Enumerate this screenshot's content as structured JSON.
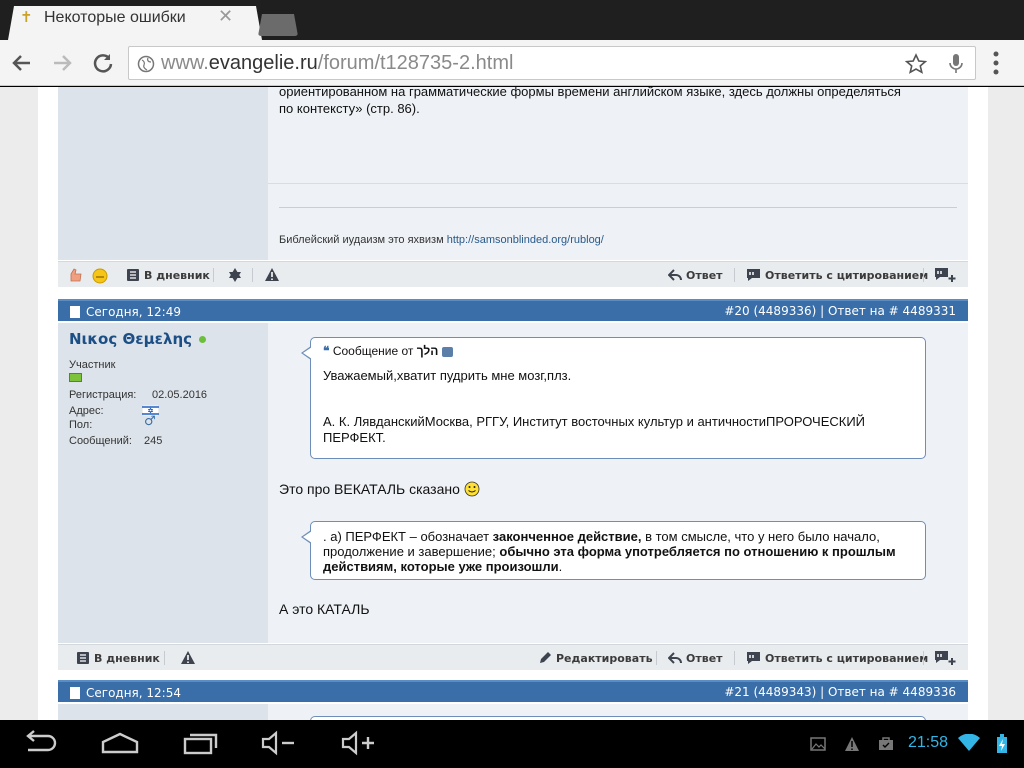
{
  "browser": {
    "tab_title": "Некоторые ошибки",
    "url_prefix": "www.",
    "url_host": "evangelie.ru",
    "url_path": "/forum/t128735-2.html"
  },
  "post19": {
    "text_line1": "ориентированном на грамматические формы времени английском языке, здесь должны определяться",
    "text_line2": "по контексту» (стр. 86).",
    "signature_prefix": "Библейский иудаизм это яхвизм",
    "signature_link": "http://samsonblinded.org/rublog/",
    "actions": {
      "diary": "В дневник",
      "reply": "Ответ",
      "reply_quote": "Ответить с цитированием"
    }
  },
  "post20": {
    "date": "Сегодня, 12:49",
    "post_ref": "#20 (4489336)",
    "reply_to": "Ответ на # 4489331",
    "username": "Νικος Θεμελης",
    "rank": "Участник",
    "reg_label": "Регистрация:",
    "reg_value": "02.05.2016",
    "address_label": "Адрес:",
    "gender_label": "Пол:",
    "posts_label": "Сообщений:",
    "posts_value": "245",
    "quote1_header_prefix": "Сообщение от",
    "quote1_author": "הלך",
    "quote1_line1": "Уважаемый,хватит пудрить мне мозг,плз.",
    "quote1_line2": "А. К. ЛявданскийМосква, РГГУ, Институт восточных культур и античностиПРОРОЧЕСКИЙ",
    "quote1_line3": "ПЕРФЕКТ.",
    "text1": "Это про ВЕКАТАЛЬ сказано",
    "quote2_a": ". а) ПЕРФЕКТ – обозначает ",
    "quote2_b": "законченное действие,",
    "quote2_c": " в том смысле, что у него было начало,",
    "quote2_d": "продолжение и завершение; ",
    "quote2_e": "обычно эта форма употребляется по отношению к прошлым",
    "quote2_f": "действиям, которые уже произошли",
    "quote2_g": ".",
    "text2": "А это КАТАЛЬ",
    "actions": {
      "diary": "В дневник",
      "edit": "Редактировать",
      "reply": "Ответ",
      "reply_quote": "Ответить с цитированием"
    }
  },
  "post21": {
    "date": "Сегодня, 12:54",
    "post_ref": "#21 (4489343)",
    "reply_to": "Ответ на # 4489336"
  },
  "status": {
    "time": "21:58"
  },
  "colors": {
    "header_blue": "#3a6ea8",
    "link": "#2a5a8a",
    "time": "#33b5e5"
  }
}
